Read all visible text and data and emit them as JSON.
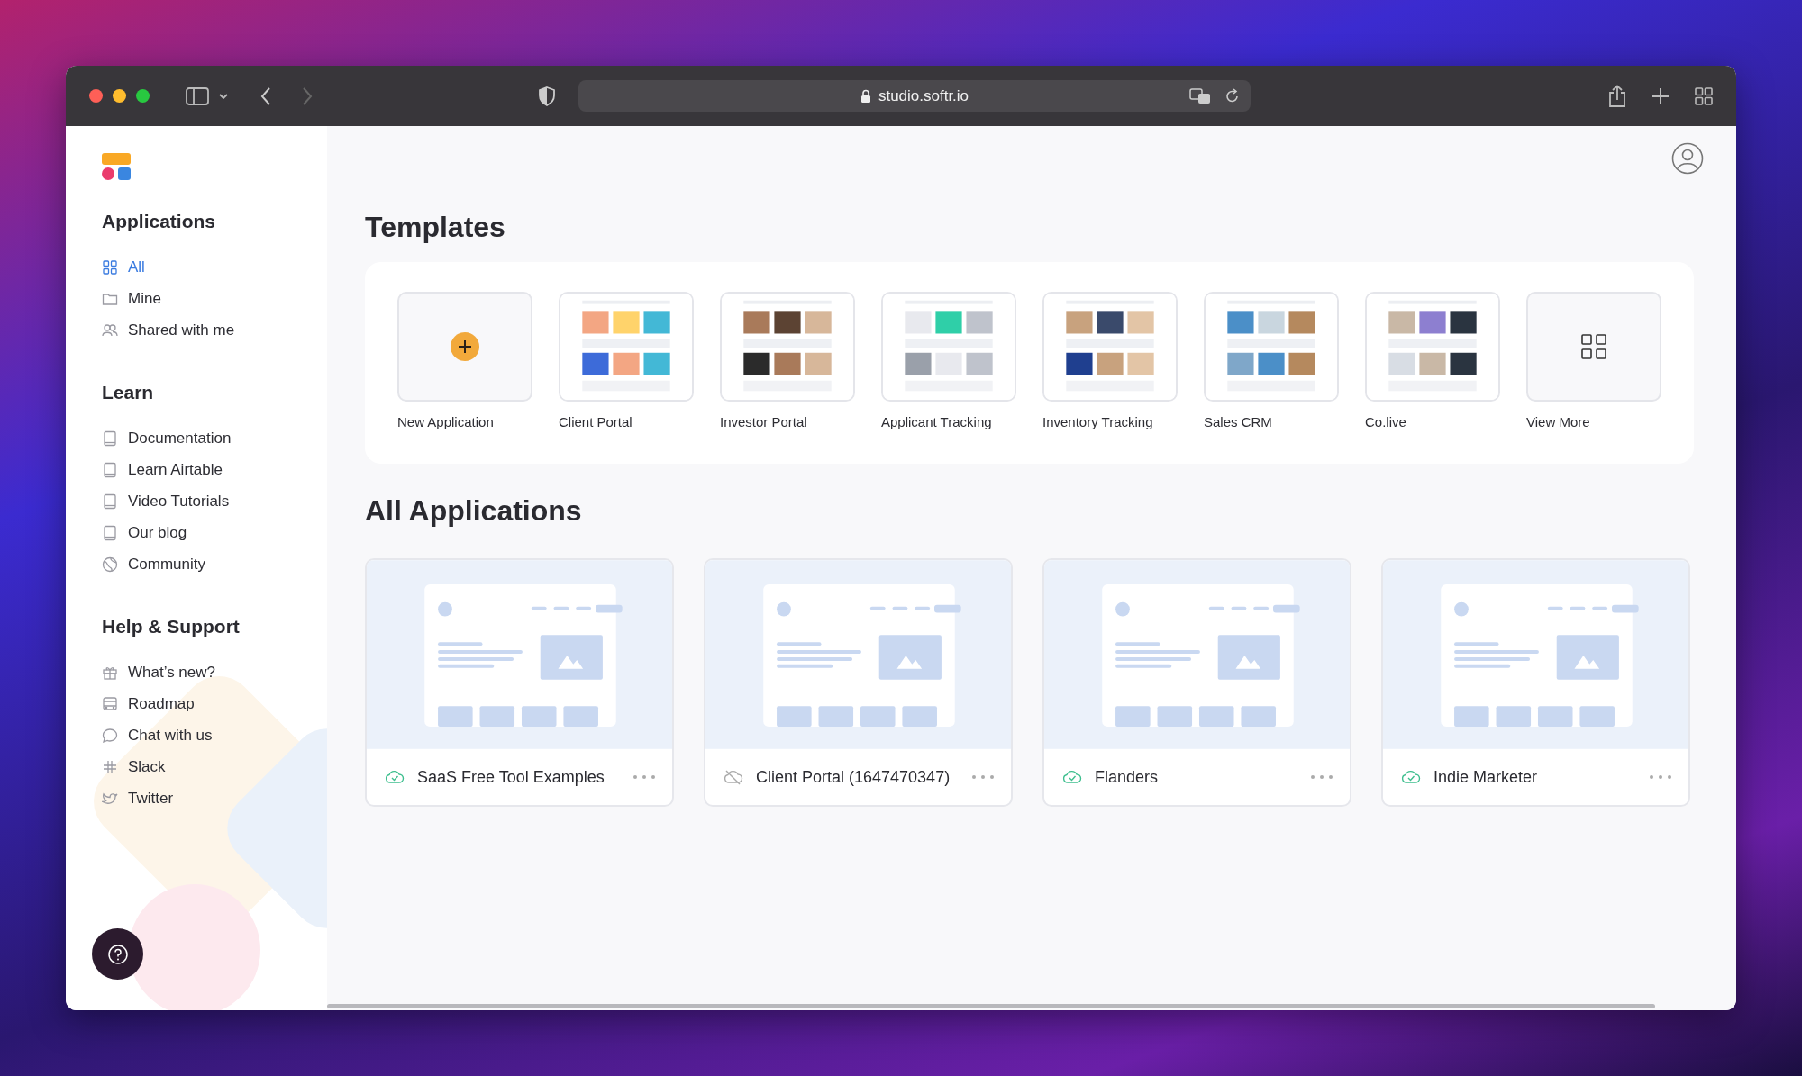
{
  "browser": {
    "url": "studio.softr.io"
  },
  "sidebar": {
    "sections": [
      {
        "title": "Applications",
        "items": [
          {
            "label": "All",
            "selected": true
          },
          {
            "label": "Mine",
            "selected": false
          },
          {
            "label": "Shared with me",
            "selected": false
          }
        ]
      },
      {
        "title": "Learn",
        "items": [
          {
            "label": "Documentation"
          },
          {
            "label": "Learn Airtable"
          },
          {
            "label": "Video Tutorials"
          },
          {
            "label": "Our blog"
          },
          {
            "label": "Community"
          }
        ]
      },
      {
        "title": "Help & Support",
        "items": [
          {
            "label": "What’s new?"
          },
          {
            "label": "Roadmap"
          },
          {
            "label": "Chat with us"
          },
          {
            "label": "Slack"
          },
          {
            "label": "Twitter"
          }
        ]
      }
    ]
  },
  "templates": {
    "title": "Templates",
    "items": [
      {
        "kind": "new",
        "label": "New Application"
      },
      {
        "kind": "picture",
        "label": "Client Portal"
      },
      {
        "kind": "picture",
        "label": "Investor Portal"
      },
      {
        "kind": "picture",
        "label": "Applicant Tracking"
      },
      {
        "kind": "picture",
        "label": "Inventory Tracking"
      },
      {
        "kind": "picture",
        "label": "Sales CRM"
      },
      {
        "kind": "picture",
        "label": "Co.live"
      },
      {
        "kind": "more",
        "label": "View More"
      }
    ]
  },
  "applications": {
    "title": "All Applications",
    "items": [
      {
        "name": "SaaS Free Tool Examples",
        "published": true
      },
      {
        "name": "Client Portal (1647470347)",
        "published": false
      },
      {
        "name": "Flanders",
        "published": true
      },
      {
        "name": "Indie Marketer",
        "published": true
      }
    ]
  }
}
